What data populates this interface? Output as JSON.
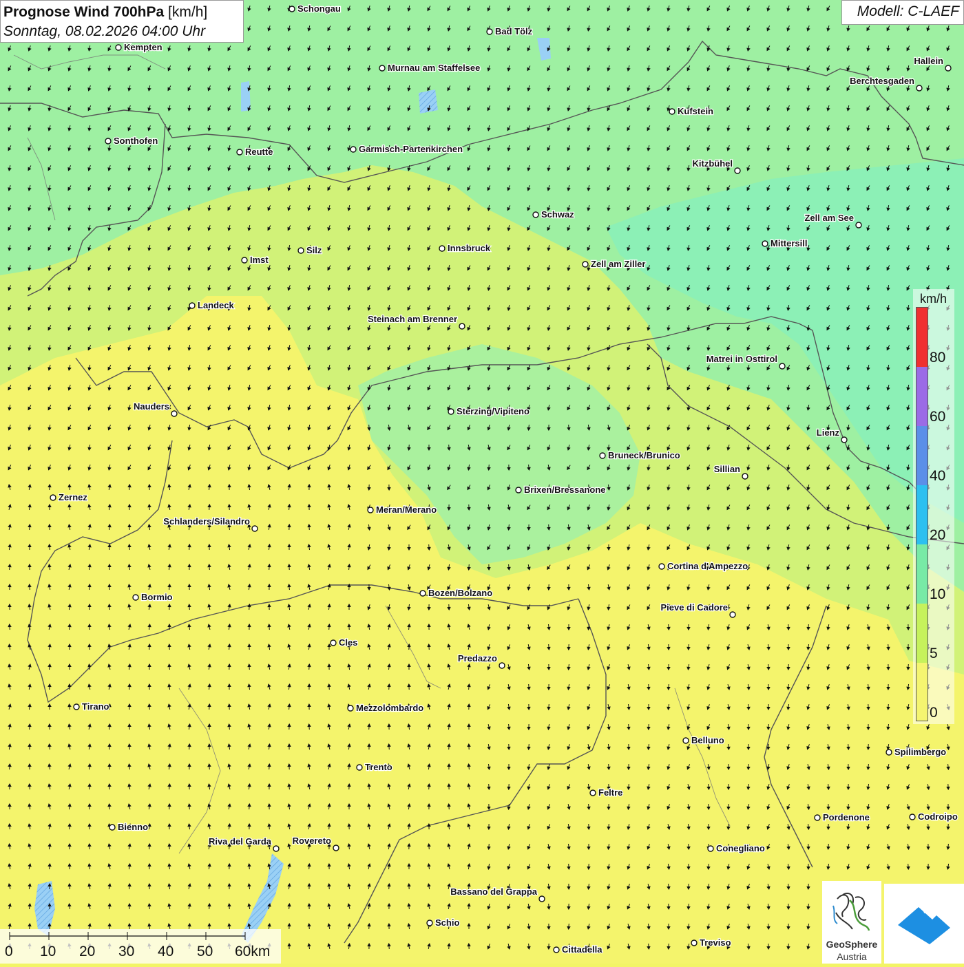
{
  "title": {
    "main_bold": "Prognose Wind 700hPa",
    "main_unit": "[km/h]",
    "datetime": "Sonntag, 08.02.2026 04:00 Uhr"
  },
  "model": "Modell: C-LAEF",
  "legend": {
    "unit": "km/h",
    "ticks": [
      "80",
      "60",
      "40",
      "20",
      "10",
      "5",
      "0"
    ],
    "colors": [
      "#f03030",
      "#9b6be6",
      "#5b8fe8",
      "#2cc0f0",
      "#78eaa6",
      "#c6f25c",
      "#f5f570"
    ]
  },
  "scalebar": {
    "labels": [
      "0",
      "10",
      "20",
      "30",
      "40",
      "50",
      "60km"
    ]
  },
  "logos": {
    "geosphere_line1": "GeoSphere",
    "geosphere_line2": "Austria"
  },
  "cities": [
    {
      "name": "Schongau"
    },
    {
      "name": "Bad Tölz"
    },
    {
      "name": "Kempten"
    },
    {
      "name": "Murnau am Staffelsee"
    },
    {
      "name": "Hallein"
    },
    {
      "name": "Berchtesgaden"
    },
    {
      "name": "Kufstein"
    },
    {
      "name": "Sonthofen"
    },
    {
      "name": "Reutte"
    },
    {
      "name": "Garmisch-Partenkirchen"
    },
    {
      "name": "Kitzbühel"
    },
    {
      "name": "Schwaz"
    },
    {
      "name": "Zell am See"
    },
    {
      "name": "Innsbruck"
    },
    {
      "name": "Mittersill"
    },
    {
      "name": "Imst"
    },
    {
      "name": "Silz"
    },
    {
      "name": "Zell am Ziller"
    },
    {
      "name": "Landeck"
    },
    {
      "name": "Steinach am Brenner"
    },
    {
      "name": "Matrei in Osttirol"
    },
    {
      "name": "Nauders"
    },
    {
      "name": "Sterzing/Vipiteno"
    },
    {
      "name": "Lienz"
    },
    {
      "name": "Bruneck/Brunico"
    },
    {
      "name": "Sillian"
    },
    {
      "name": "Zernez"
    },
    {
      "name": "Brixen/Bressanone"
    },
    {
      "name": "Meran/Merano"
    },
    {
      "name": "Schlanders/Silandro"
    },
    {
      "name": "Cortina d'Ampezzo"
    },
    {
      "name": "Bozen/Bolzano"
    },
    {
      "name": "Bormio"
    },
    {
      "name": "Pieve di Cadore"
    },
    {
      "name": "Cles"
    },
    {
      "name": "Predazzo"
    },
    {
      "name": "Tirano"
    },
    {
      "name": "Mezzolombardo"
    },
    {
      "name": "Belluno"
    },
    {
      "name": "Spilimbergo"
    },
    {
      "name": "Trento"
    },
    {
      "name": "Feltre"
    },
    {
      "name": "Bienno"
    },
    {
      "name": "Pordenone"
    },
    {
      "name": "Codroipo"
    },
    {
      "name": "Riva del Garda"
    },
    {
      "name": "Rovereto"
    },
    {
      "name": "Conegliano"
    },
    {
      "name": "Bassano del Grappa"
    },
    {
      "name": "Schio"
    },
    {
      "name": "Treviso"
    },
    {
      "name": "Cittadella"
    }
  ]
}
